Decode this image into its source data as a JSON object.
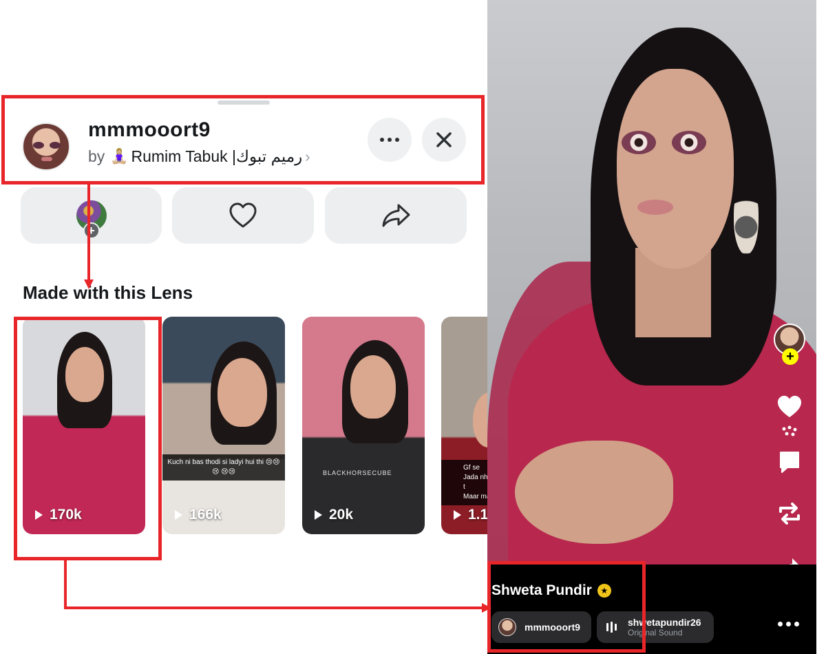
{
  "lens_header": {
    "title": "mmmooort9",
    "by_label": "by",
    "creator_emoji": "🧘🏼‍♀️",
    "creator_name": "Rumim Tabuk |رميم تبوك",
    "chevron": "›"
  },
  "section": {
    "title": "Made with this Lens"
  },
  "thumbnails": [
    {
      "views": "170k"
    },
    {
      "views": "166k",
      "caption": "Kuch ni bas thodi si ladyi hui thi 😢😢😢 😢😢"
    },
    {
      "views": "20k",
      "shirt_text": "BLACKHORSECUBE"
    },
    {
      "views": "1.1",
      "caption": "Gf se\nJada nhi t\nMaar ma"
    }
  ],
  "video": {
    "creator_name": "Shweta Pundir",
    "badge_icon": "star-icon",
    "lens_chip_label": "mmmooort9",
    "sound_user": "shwetapundir26",
    "sound_label": "Original Sound",
    "rail_icons": [
      "heart-icon",
      "chat-icon",
      "repost-icon",
      "share-icon"
    ]
  },
  "colors": {
    "annotation_red": "#e8262a",
    "snap_yellow": "#fffc00",
    "button_gray": "#eceef0"
  }
}
